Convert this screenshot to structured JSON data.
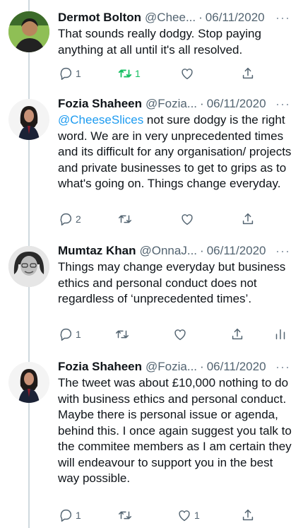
{
  "tweets": [
    {
      "name": "Dermot Bolton",
      "handle": "@Chee...",
      "separator": "·",
      "date": "06/11/2020",
      "more": "···",
      "text": "That sounds really dodgy. Stop paying anything at all until it's all resolved.",
      "replies": "1",
      "retweets": "1",
      "likes": "",
      "retweeted": true,
      "show_analytics": false
    },
    {
      "name": "Fozia Shaheen",
      "handle": "@Fozia...",
      "separator": "·",
      "date": "06/11/2020",
      "more": "···",
      "mention": "@CheeseSlices",
      "text": " not sure dodgy is the right word. We are in very unprecedented times and its difficult for any organisation/ projects and private businesses to get to grips as to what's going on. Things change everyday.",
      "replies": "2",
      "retweets": "",
      "likes": "",
      "retweeted": false,
      "show_analytics": false
    },
    {
      "name": "Mumtaz Khan",
      "handle": "@OnnaJ...",
      "separator": "·",
      "date": "06/11/2020",
      "more": "···",
      "text": "Things may change everyday but business ethics and personal conduct does not regardless of ‘unprecedented times’.",
      "replies": "1",
      "retweets": "",
      "likes": "",
      "retweeted": false,
      "show_analytics": true
    },
    {
      "name": "Fozia Shaheen",
      "handle": "@Fozia...",
      "separator": "·",
      "date": "06/11/2020",
      "more": "···",
      "text": "The tweet was about £10,000 nothing to do with business ethics and personal conduct. Maybe there is personal issue or agenda, behind this. I once again suggest you talk to the commitee members as I am certain they will endeavour to support you in the best way possible.",
      "replies": "1",
      "retweets": "",
      "likes": "1",
      "retweeted": false,
      "show_analytics": false
    }
  ],
  "colors": {
    "link": "#1d9bf0",
    "retweet_active": "#17bf63",
    "secondary": "#536471",
    "thread_line": "#cfd9de"
  }
}
